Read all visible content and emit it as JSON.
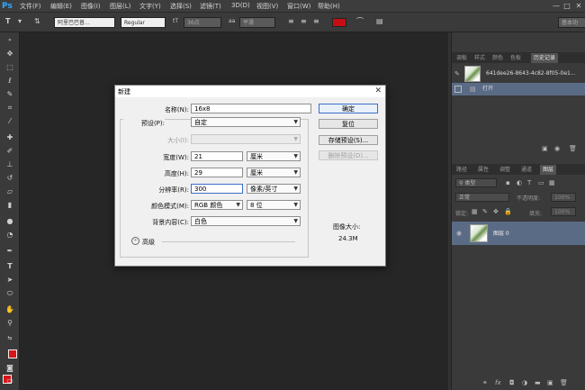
{
  "app": {
    "logo": "Ps",
    "menu": [
      "文件(F)",
      "编辑(E)",
      "图像(I)",
      "图层(L)",
      "文字(Y)",
      "选择(S)",
      "滤镜(T)",
      "3D(D)",
      "视图(V)",
      "窗口(W)",
      "帮助(H)"
    ],
    "window_controls": {
      "minimize": "—",
      "maximize": "□",
      "close": "✕"
    }
  },
  "options_bar": {
    "font_family": "阿里巴巴普...",
    "font_style": "Regular",
    "font_size": "36点",
    "antialias": "平滑",
    "workspace": "基本功"
  },
  "history_panel": {
    "tabs": [
      "调板",
      "样式",
      "颜色",
      "色板",
      "历史记录"
    ],
    "active_tab": "历史记录",
    "snapshot_label": "641dee26-8643-4c82-8f05-0e1...",
    "step_label": "打开"
  },
  "layers_panel": {
    "tabs": [
      "路径",
      "属性",
      "调整",
      "通道",
      "图层"
    ],
    "active_tab": "图层",
    "filter_label": "类型",
    "blend_mode": "正常",
    "opacity_label": "不透明度:",
    "opacity_value": "100%",
    "lock_label": "锁定:",
    "fill_label": "填充:",
    "fill_value": "100%",
    "layer_name": "图层 0"
  },
  "dialog": {
    "title": "新建",
    "name_label": "名称(N):",
    "name_value": "16x8",
    "preset_label": "预设(P):",
    "preset_value": "自定",
    "size_label": "大小(I):",
    "width_label": "宽度(W):",
    "width_value": "21",
    "width_unit": "厘米",
    "height_label": "高度(H):",
    "height_value": "29",
    "height_unit": "厘米",
    "resolution_label": "分辨率(R):",
    "resolution_value": "300",
    "resolution_unit": "像素/英寸",
    "color_mode_label": "颜色模式(M):",
    "color_mode_value": "RGB 颜色",
    "bit_depth_value": "8 位",
    "background_label": "背景内容(C):",
    "background_value": "白色",
    "advanced_label": "高级",
    "ok_label": "确定",
    "reset_label": "复位",
    "save_preset_label": "存储预设(S)...",
    "delete_preset_label": "删除预设(D)...",
    "image_size_label": "图像大小:",
    "image_size_value": "24.3M"
  },
  "colors": {
    "foreground": "#d8141a",
    "background": "#d8141a",
    "ps_blue": "#31a8ff",
    "focus_blue": "#3a6ec8"
  }
}
